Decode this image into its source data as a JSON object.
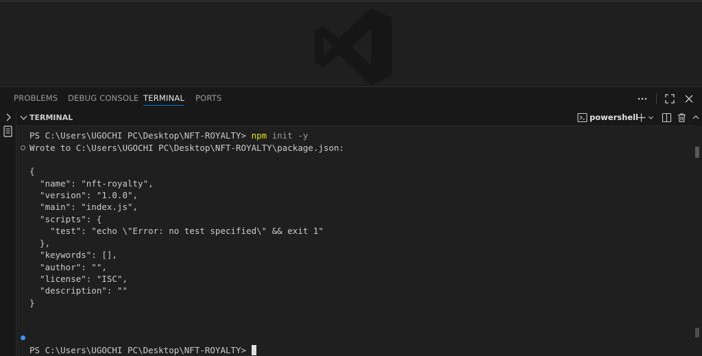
{
  "panel": {
    "tabs": [
      {
        "label": "PROBLEMS"
      },
      {
        "label": "DEBUG CONSOLE"
      },
      {
        "label": "TERMINAL"
      },
      {
        "label": "PORTS"
      }
    ],
    "active_tab": "TERMINAL"
  },
  "terminal": {
    "header_title": "TERMINAL",
    "shell_name": "powershell",
    "lines": [
      {
        "prompt": "PS C:\\Users\\UGOCHI PC\\Desktop\\NFT-ROYALTY> ",
        "cmd": "npm",
        "args": " init -y"
      },
      {
        "text": "Wrote to C:\\Users\\UGOCHI PC\\Desktop\\NFT-ROYALTY\\package.json:"
      },
      {
        "text": "{"
      },
      {
        "text": "  \"name\": \"nft-royalty\","
      },
      {
        "text": "  \"version\": \"1.0.0\","
      },
      {
        "text": "  \"main\": \"index.js\","
      },
      {
        "text": "  \"scripts\": {"
      },
      {
        "text": "    \"test\": \"echo \\\"Error: no test specified\\\" && exit 1\""
      },
      {
        "text": "  },"
      },
      {
        "text": "  \"keywords\": [],"
      },
      {
        "text": "  \"author\": \"\","
      },
      {
        "text": "  \"license\": \"ISC\","
      },
      {
        "text": "  \"description\": \"\""
      },
      {
        "text": "}"
      },
      {
        "prompt": "PS C:\\Users\\UGOCHI PC\\Desktop\\NFT-ROYALTY> "
      }
    ]
  },
  "colors": {
    "accent": "#0078d4",
    "command": "#e5e510",
    "success_dot": "#3794ff"
  },
  "icons": [
    "vscode-logo-icon",
    "more-icon",
    "maximize-icon",
    "chevron-right-icon",
    "chevron-down-icon",
    "terminal-icon",
    "plus-icon",
    "split-icon",
    "trash-icon",
    "chevron-up-icon",
    "sidebar-file-icon"
  ]
}
